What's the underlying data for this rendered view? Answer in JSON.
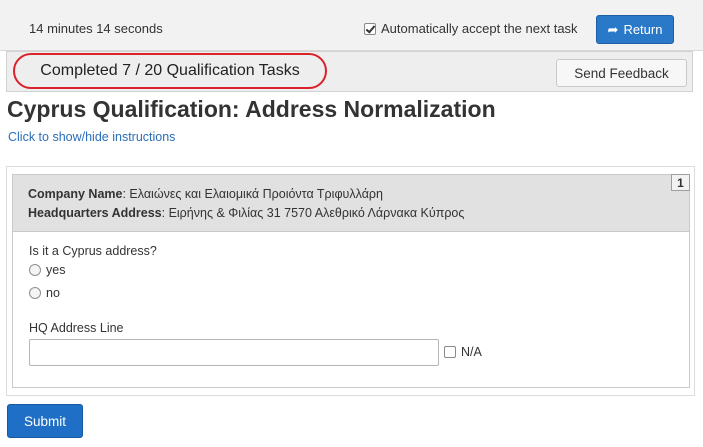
{
  "header": {
    "timer": "14 minutes 14 seconds",
    "auto_accept_label": "Automatically accept the next task",
    "auto_accept_checked": true,
    "return_label": "Return"
  },
  "status": {
    "completed_text": "Completed 7 / 20 Qualification Tasks",
    "feedback_label": "Send Feedback"
  },
  "task": {
    "title": "Cyprus Qualification: Address Normalization",
    "instructions_link": "Click to show/hide instructions",
    "item_number": "1",
    "company_name_label": "Company Name",
    "company_name_value": ": Ελαιώνες και Ελαιομικά Προιόντα Τριφυλλάρη",
    "hq_address_label": "Headquarters Address",
    "hq_address_value": ": Ειρήνης & Φιλίας 31 7570 Αλεθρικό Λάρνακα Κύπρος",
    "question": "Is it a Cyprus address?",
    "options": [
      "yes",
      "no"
    ],
    "hq_line_label": "HQ Address Line",
    "hq_line_value": "",
    "na_label": "N/A",
    "na_checked": false
  },
  "footer": {
    "submit_label": "Submit"
  },
  "colors": {
    "primary_button": "#2a79c9",
    "highlight_circle": "#d9232b",
    "link": "#2a6ebb"
  }
}
